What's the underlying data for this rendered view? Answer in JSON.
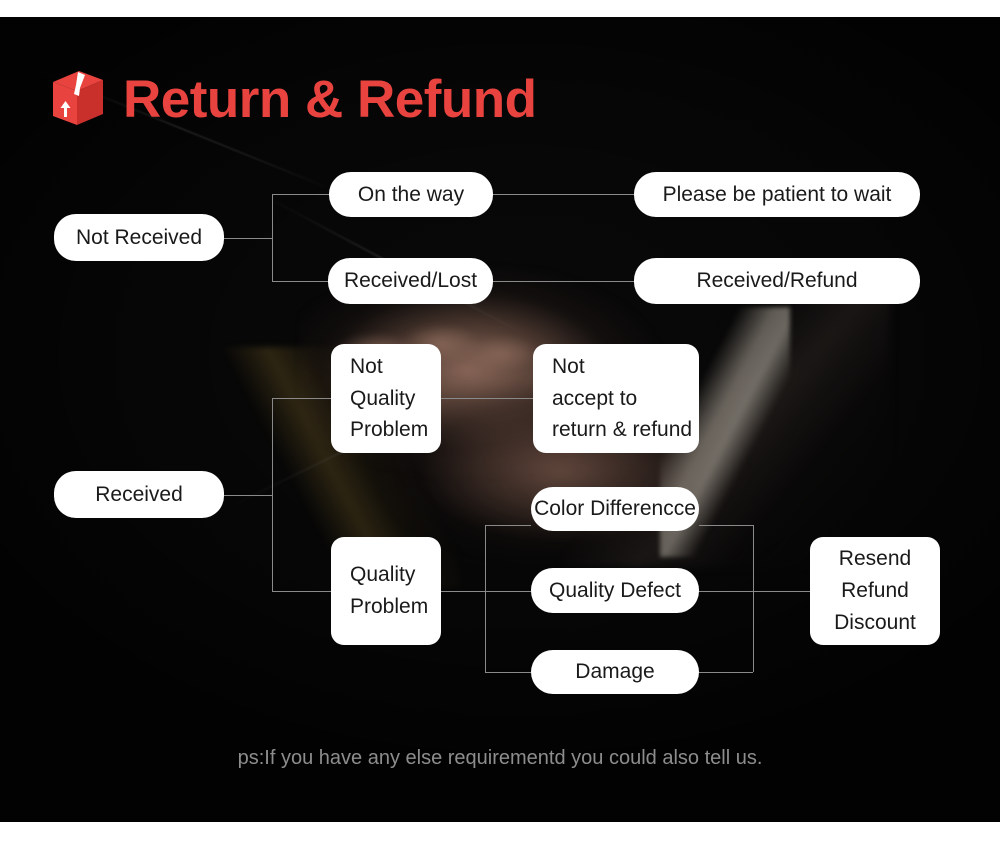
{
  "header": {
    "title": "Return & Refund",
    "icon": "package-box-icon",
    "accent_color": "#e8433f"
  },
  "theme": {
    "background": "#090909",
    "node_background": "#ffffff",
    "node_text": "#1a1a1a",
    "connector_color": "#8a8a8a",
    "note_color": "#8d8d8d"
  },
  "flow": {
    "nodes": [
      {
        "id": "not-received",
        "label": "Not Received"
      },
      {
        "id": "on-the-way",
        "label": "On the way"
      },
      {
        "id": "received-lost",
        "label": "Received/Lost"
      },
      {
        "id": "please-be-patient",
        "label": "Please be patient to wait"
      },
      {
        "id": "received-refund",
        "label": "Received/Refund"
      },
      {
        "id": "received",
        "label": "Received"
      },
      {
        "id": "not-quality-problem",
        "label": "Not\nQuality\nProblem"
      },
      {
        "id": "not-accept",
        "label": "Not\naccept to\nreturn & refund"
      },
      {
        "id": "quality-problem",
        "label": "Quality\nProblem"
      },
      {
        "id": "color-difference",
        "label": "Color Differencce"
      },
      {
        "id": "quality-defect",
        "label": "Quality Defect"
      },
      {
        "id": "damage",
        "label": "Damage"
      },
      {
        "id": "resend-refund-discount",
        "label": "Resend\nRefund\nDiscount"
      }
    ]
  },
  "note": "ps:If you have any else requirementd you could also tell us."
}
